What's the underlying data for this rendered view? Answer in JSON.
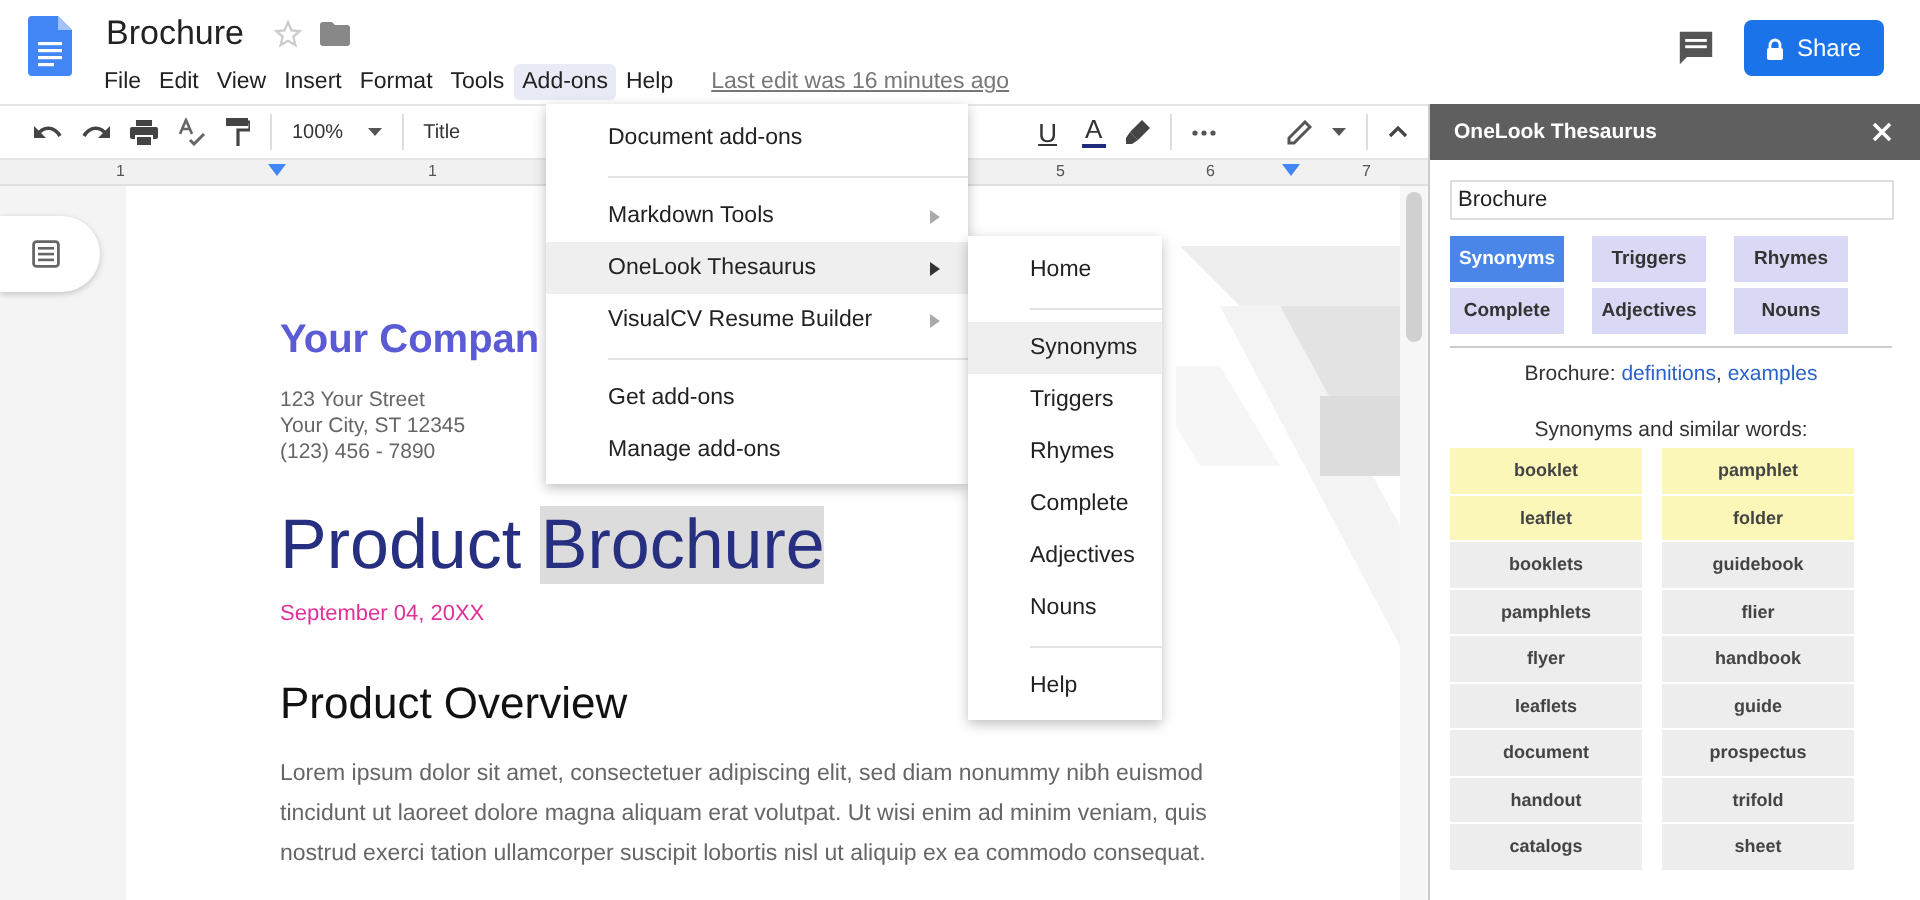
{
  "document": {
    "title": "Brochure",
    "last_edit": "Last edit was 16 minutes ago",
    "share_label": "Share"
  },
  "menu_bar": [
    {
      "label": "File",
      "selected": false
    },
    {
      "label": "Edit",
      "selected": false
    },
    {
      "label": "View",
      "selected": false
    },
    {
      "label": "Insert",
      "selected": false
    },
    {
      "label": "Format",
      "selected": false
    },
    {
      "label": "Tools",
      "selected": false
    },
    {
      "label": "Add-ons",
      "selected": true
    },
    {
      "label": "Help",
      "selected": false
    }
  ],
  "toolbar": {
    "zoom": "100%",
    "style": "Title",
    "underline": "U",
    "text_color": "A"
  },
  "ruler": [
    "1",
    "1",
    "5",
    "6",
    "7"
  ],
  "page": {
    "company": "Your Compan",
    "address_lines": [
      "123 Your Street",
      "Your City, ST 12345",
      "(123) 456 - 7890"
    ],
    "title_start": "Product",
    "title_highlight": "Brochure",
    "date": "September 04, 20XX",
    "heading": "Product Overview",
    "body_lines": [
      "Lorem ipsum dolor sit amet, consectetuer adipiscing elit, sed diam nonummy nibh euismod",
      "tincidunt ut laoreet dolore magna aliquam erat volutpat. Ut wisi enim ad minim veniam, quis",
      "nostrud exerci tation ullamcorper suscipit lobortis nisl ut aliquip ex ea commodo consequat."
    ]
  },
  "addons_menu": [
    {
      "kind": "item",
      "label": "Document add-ons",
      "submenu": false,
      "selected": false
    },
    {
      "kind": "divider"
    },
    {
      "kind": "item",
      "label": "Markdown Tools",
      "submenu": true,
      "selected": false
    },
    {
      "kind": "item",
      "label": "OneLook Thesaurus",
      "submenu": true,
      "selected": true
    },
    {
      "kind": "item",
      "label": "VisualCV Resume Builder",
      "submenu": true,
      "selected": false
    },
    {
      "kind": "divider"
    },
    {
      "kind": "item",
      "label": "Get add-ons",
      "submenu": false,
      "selected": false
    },
    {
      "kind": "item",
      "label": "Manage add-ons",
      "submenu": false,
      "selected": false
    }
  ],
  "submenu": [
    {
      "kind": "item",
      "label": "Home",
      "selected": false
    },
    {
      "kind": "divider"
    },
    {
      "kind": "item",
      "label": "Synonyms",
      "selected": true
    },
    {
      "kind": "item",
      "label": "Triggers",
      "selected": false
    },
    {
      "kind": "item",
      "label": "Rhymes",
      "selected": false
    },
    {
      "kind": "item",
      "label": "Complete",
      "selected": false
    },
    {
      "kind": "item",
      "label": "Adjectives",
      "selected": false
    },
    {
      "kind": "item",
      "label": "Nouns",
      "selected": false
    },
    {
      "kind": "divider"
    },
    {
      "kind": "item",
      "label": "Help",
      "selected": false
    }
  ],
  "sidebar": {
    "title": "OneLook Thesaurus",
    "search_value": "Brochure",
    "modes": [
      {
        "label": "Synonyms",
        "selected": true
      },
      {
        "label": "Triggers",
        "selected": false
      },
      {
        "label": "Rhymes",
        "selected": false
      },
      {
        "label": "Complete",
        "selected": false
      },
      {
        "label": "Adjectives",
        "selected": false
      },
      {
        "label": "Nouns",
        "selected": false
      }
    ],
    "lookup_word": "Brochure:",
    "lookup_links": [
      "definitions",
      "examples"
    ],
    "lookup_separator": ",",
    "results_heading": "Synonyms and similar words:",
    "results": [
      {
        "word": "booklet",
        "highlighted": true
      },
      {
        "word": "pamphlet",
        "highlighted": true
      },
      {
        "word": "leaflet",
        "highlighted": true
      },
      {
        "word": "folder",
        "highlighted": true
      },
      {
        "word": "booklets",
        "highlighted": false
      },
      {
        "word": "guidebook",
        "highlighted": false
      },
      {
        "word": "pamphlets",
        "highlighted": false
      },
      {
        "word": "flier",
        "highlighted": false
      },
      {
        "word": "flyer",
        "highlighted": false
      },
      {
        "word": "handbook",
        "highlighted": false
      },
      {
        "word": "leaflets",
        "highlighted": false
      },
      {
        "word": "guide",
        "highlighted": false
      },
      {
        "word": "document",
        "highlighted": false
      },
      {
        "word": "prospectus",
        "highlighted": false
      },
      {
        "word": "handout",
        "highlighted": false
      },
      {
        "word": "trifold",
        "highlighted": false
      },
      {
        "word": "catalogs",
        "highlighted": false
      },
      {
        "word": "sheet",
        "highlighted": false
      }
    ]
  }
}
